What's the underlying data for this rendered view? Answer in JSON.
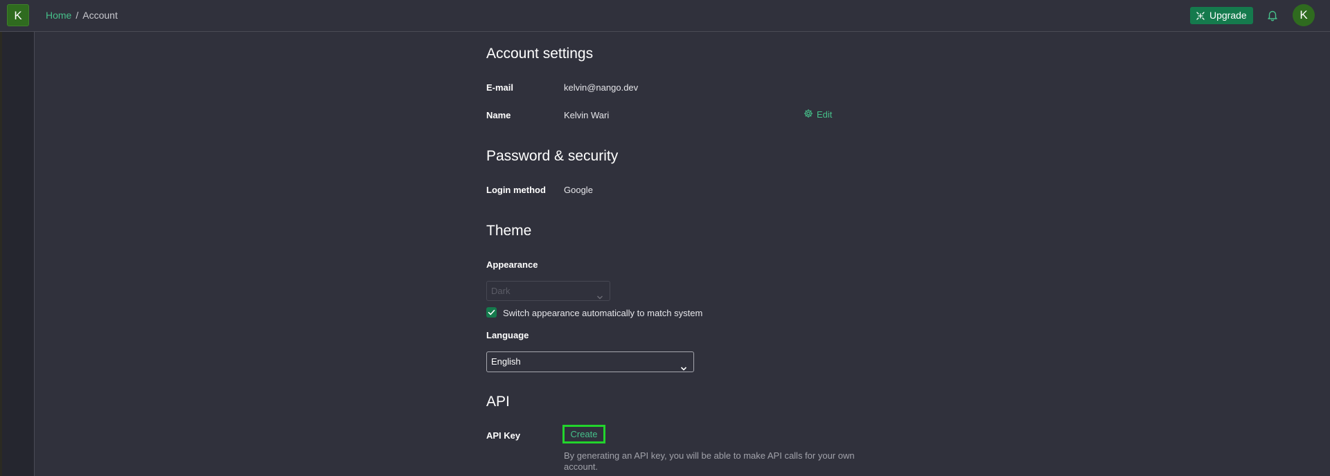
{
  "header": {
    "logo_letter": "K",
    "breadcrumb": {
      "home": "Home",
      "separator": "/",
      "current": "Account"
    },
    "upgrade_label": "Upgrade",
    "avatar_letter": "K",
    "icons": {
      "upgrade": "sparkle-icon",
      "notifications": "bell-icon"
    }
  },
  "account": {
    "title": "Account settings",
    "email_label": "E-mail",
    "email_value": "kelvin@nango.dev",
    "name_label": "Name",
    "name_value": "Kelvin Wari",
    "edit_label": "Edit"
  },
  "security": {
    "title": "Password & security",
    "login_label": "Login method",
    "login_value": "Google"
  },
  "theme": {
    "title": "Theme",
    "appearance_label": "Appearance",
    "appearance_value": "Dark",
    "auto_switch_label": "Switch appearance automatically to match system",
    "auto_switch_checked": true,
    "language_label": "Language",
    "language_value": "English"
  },
  "api": {
    "title": "API",
    "key_label": "API Key",
    "create_label": "Create",
    "help_text": "By generating an API key, you will be able to make API calls for your own account."
  },
  "colors": {
    "accent": "#157a4d",
    "link": "#46c08a",
    "background": "#30313c",
    "highlight": "#22d42c"
  }
}
